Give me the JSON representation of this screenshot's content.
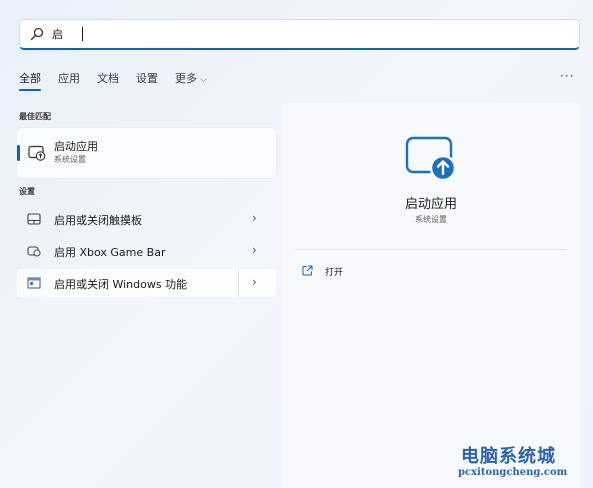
{
  "search": {
    "value": "启"
  },
  "filters": [
    {
      "label": "全部",
      "active": true
    },
    {
      "label": "应用"
    },
    {
      "label": "文档"
    },
    {
      "label": "设置"
    },
    {
      "label": "更多"
    }
  ],
  "more_options_label": "···",
  "best_match": {
    "section_label": "最佳匹配",
    "title": "启动应用",
    "subtitle": "系统设置"
  },
  "settings": {
    "section_label": "设置",
    "items": [
      {
        "label": "启用或关闭触摸板",
        "icon": "touchpad-icon"
      },
      {
        "label": "启用 Xbox Game Bar",
        "icon": "gamebar-icon"
      },
      {
        "label": "启用或关闭 Windows 功能",
        "icon": "windows-features-icon"
      }
    ]
  },
  "preview": {
    "title": "启动应用",
    "subtitle": "系统设置",
    "open_label": "打开"
  },
  "watermark": {
    "title": "电脑系统城",
    "url": "pcxitongcheng.com"
  },
  "colors": {
    "accent": "#0067c0",
    "icon_blue": "#1f6fc0"
  }
}
